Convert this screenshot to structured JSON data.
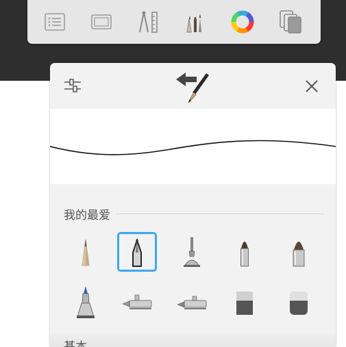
{
  "toolbar": {
    "buttons": [
      {
        "name": "layers-list-icon"
      },
      {
        "name": "canvas-frame-icon"
      },
      {
        "name": "ruler-guides-icon"
      },
      {
        "name": "brush-library-icon"
      },
      {
        "name": "color-wheel-icon"
      },
      {
        "name": "copy-layers-icon"
      }
    ]
  },
  "brush_panel": {
    "settings_icon": "sliders-icon",
    "brush_icon": "brush-swap-icon",
    "close_icon": "close-icon",
    "favorites_title": "我的最爱",
    "next_section_title": "基本",
    "brushes": [
      {
        "name": "pencil-brush",
        "selected": false
      },
      {
        "name": "ballpoint-brush",
        "selected": true
      },
      {
        "name": "technical-pen-brush",
        "selected": false
      },
      {
        "name": "paintbrush-brush",
        "selected": false
      },
      {
        "name": "wide-paintbrush-brush",
        "selected": false
      },
      {
        "name": "marker-brush",
        "selected": false
      },
      {
        "name": "airbrush-brush",
        "selected": false
      },
      {
        "name": "fine-airbrush-brush",
        "selected": false
      },
      {
        "name": "hard-eraser-brush",
        "selected": false
      },
      {
        "name": "soft-eraser-brush",
        "selected": false
      }
    ]
  },
  "colors": {
    "selection": "#3ea6ec",
    "panel_bg": "#f2f2f2",
    "toolbar_bg": "#e6e6e6",
    "backdrop": "#2e2e2e"
  }
}
